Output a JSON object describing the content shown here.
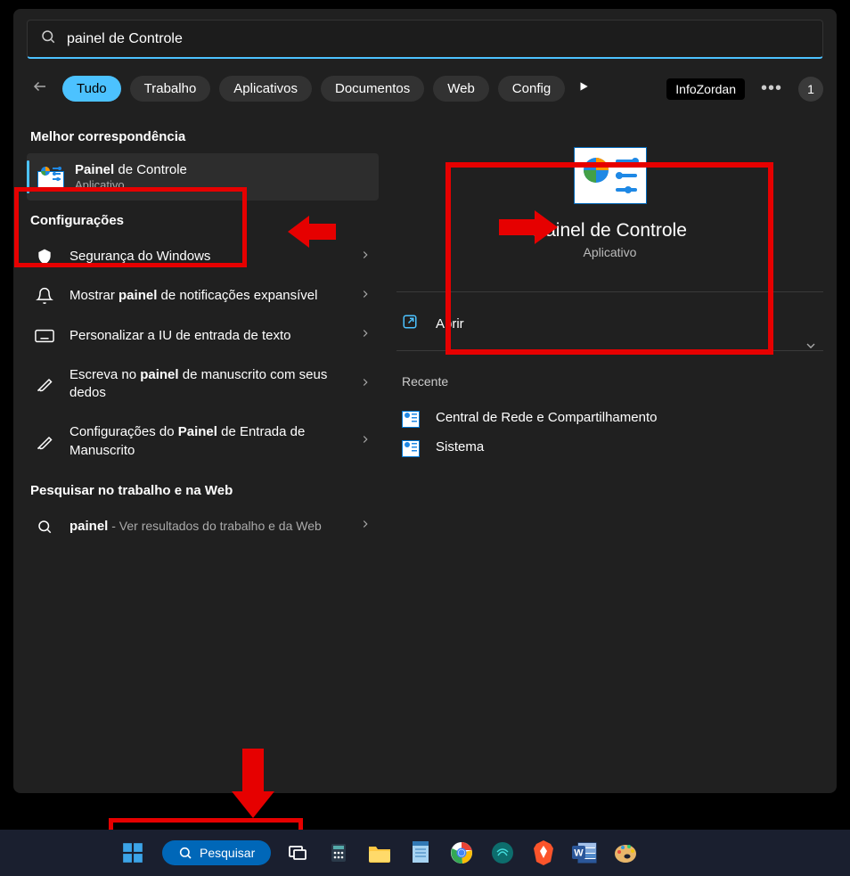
{
  "search": {
    "query": "painel de Controle",
    "query_typed": "painel",
    "query_ghost": " de Controle"
  },
  "tabs": [
    "Tudo",
    "Trabalho",
    "Aplicativos",
    "Documentos",
    "Web",
    "Config"
  ],
  "brand": "InfoZordan",
  "avatar_badge": "1",
  "sections": {
    "best_match": "Melhor correspondência",
    "settings": "Configurações",
    "search_work_web": "Pesquisar no trabalho e na Web"
  },
  "best_match_item": {
    "title_bold": "Painel",
    "title_rest": " de Controle",
    "subtitle": "Aplicativo"
  },
  "settings_items": [
    {
      "icon": "shield",
      "text": "Segurança do Windows"
    },
    {
      "icon": "bell",
      "text_before": "Mostrar ",
      "text_bold": "painel",
      "text_after": " de notificações expansível"
    },
    {
      "icon": "keyboard",
      "text": "Personalizar a IU de entrada de texto"
    },
    {
      "icon": "pen",
      "text_before": "Escreva no ",
      "text_bold": "painel",
      "text_after": " de manuscrito com seus dedos"
    },
    {
      "icon": "pen",
      "text_before": "Configurações do ",
      "text_bold": "Painel",
      "text_after": " de Entrada de Manuscrito"
    }
  ],
  "web_item": {
    "term": "painel",
    "desc": " - Ver resultados do trabalho e da Web"
  },
  "detail": {
    "title": "Painel de Controle",
    "subtitle": "Aplicativo",
    "open": "Abrir",
    "recent_label": "Recente",
    "recent": [
      "Central de Rede e Compartilhamento",
      "Sistema"
    ]
  },
  "taskbar": {
    "search_label": "Pesquisar"
  }
}
